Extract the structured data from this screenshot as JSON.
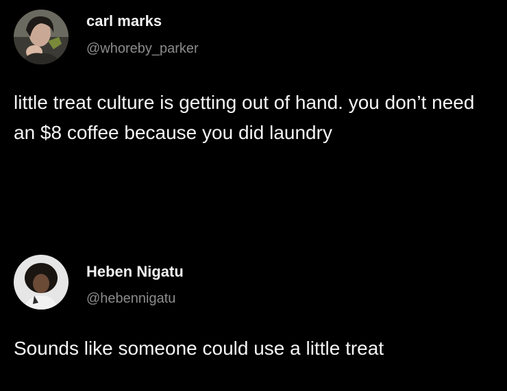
{
  "tweets": [
    {
      "display_name": "carl marks",
      "handle": "@whoreby_parker",
      "text": "little treat culture is getting out of hand. you don’t need an $8 coffee because you did laundry",
      "avatar_icon": "profile-photo-icon"
    },
    {
      "display_name": "Heben Nigatu",
      "handle": "@hebennigatu",
      "text": "Sounds like someone could use a little treat",
      "avatar_icon": "profile-photo-icon"
    }
  ],
  "colors": {
    "background": "#000000",
    "name": "#f2f2f2",
    "handle": "#8c8c8c",
    "text": "#f5f5f5"
  }
}
